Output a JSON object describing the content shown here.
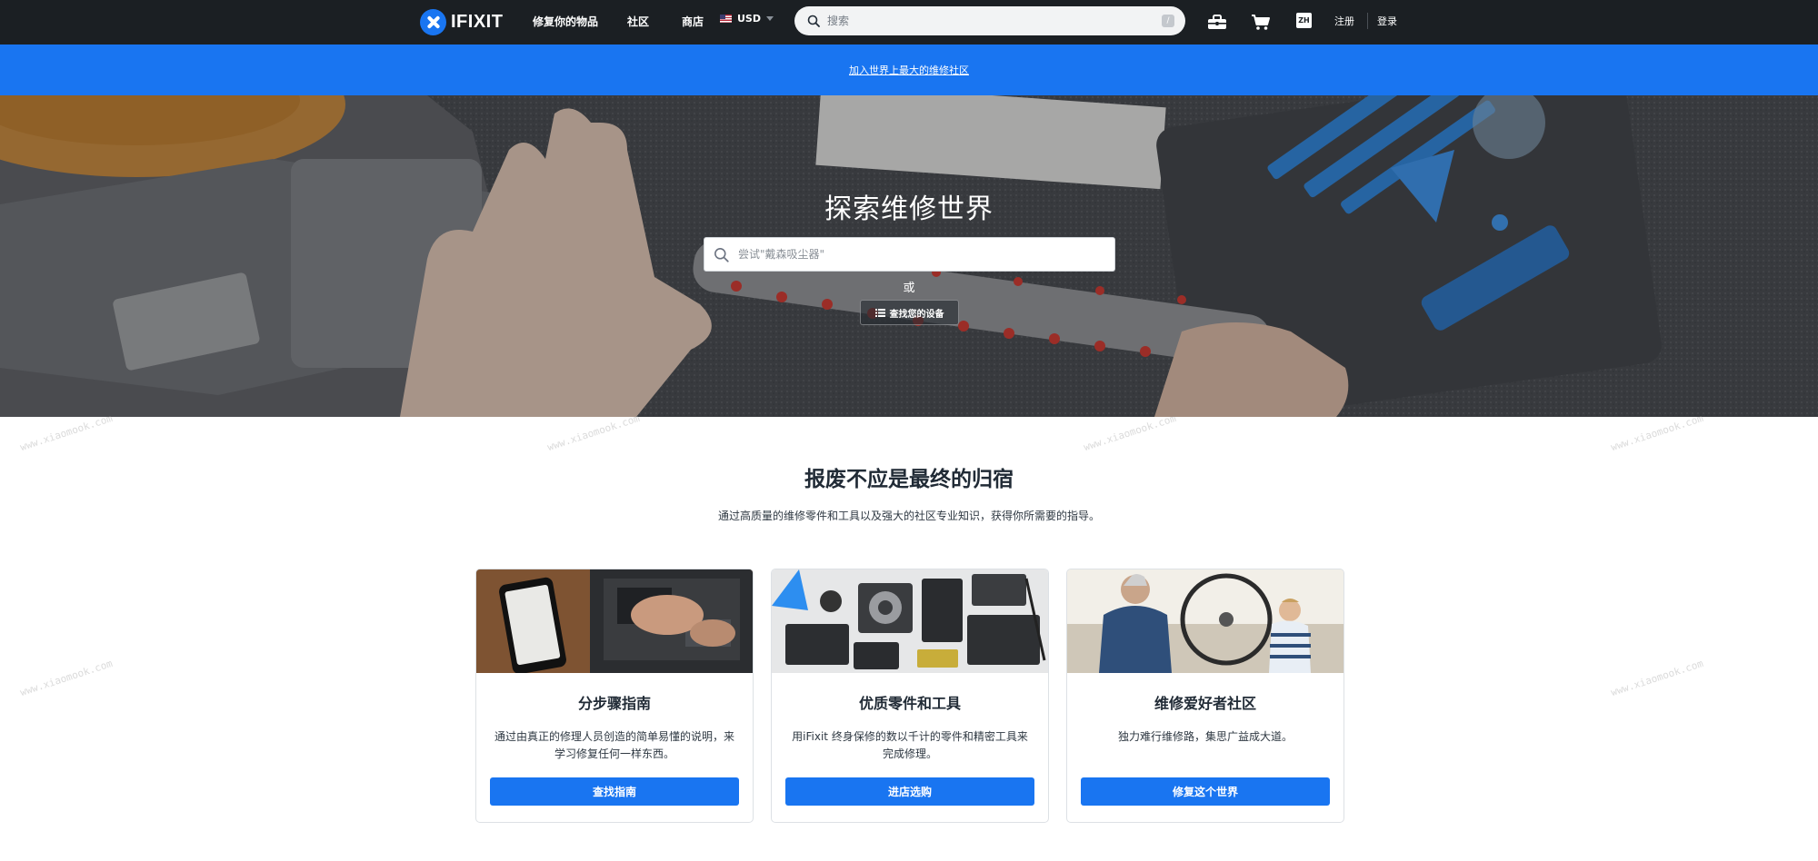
{
  "nav": {
    "logo_text": "IFIXIT",
    "links": [
      "修复你的物品",
      "社区",
      "商店"
    ],
    "currency": "USD",
    "search_placeholder": "搜索",
    "search_shortcut": "/",
    "language": "ZH",
    "signup": "注册",
    "login": "登录",
    "icons": [
      "toolbox-icon",
      "cart-icon"
    ]
  },
  "banner": {
    "link_text": "加入世界上最大的维修社区"
  },
  "hero": {
    "title": "探索维修世界",
    "search_placeholder": "尝试\"戴森吸尘器\"",
    "or_text": "或",
    "device_button": "查找您的设备"
  },
  "intro": {
    "title": "报废不应是最终的归宿",
    "subtitle": "通过高质量的维修零件和工具以及强大的社区专业知识，获得你所需要的指导。"
  },
  "cards": [
    {
      "title": "分步骤指南",
      "description": "通过由真正的修理人员创造的简单易懂的说明，来学习修复任何一样东西。",
      "button": "查找指南"
    },
    {
      "title": "优质零件和工具",
      "description": "用iFixit 终身保修的数以千计的零件和精密工具来完成修理。",
      "button": "进店选购"
    },
    {
      "title": "维修爱好者社区",
      "description": "独力难行维修路，集思广益成大道。",
      "button": "修复这个世界"
    }
  ],
  "watermark_text": "www.xiaomook.com",
  "colors": {
    "accent": "#1975f1",
    "nav_bg": "#1b1f23"
  }
}
